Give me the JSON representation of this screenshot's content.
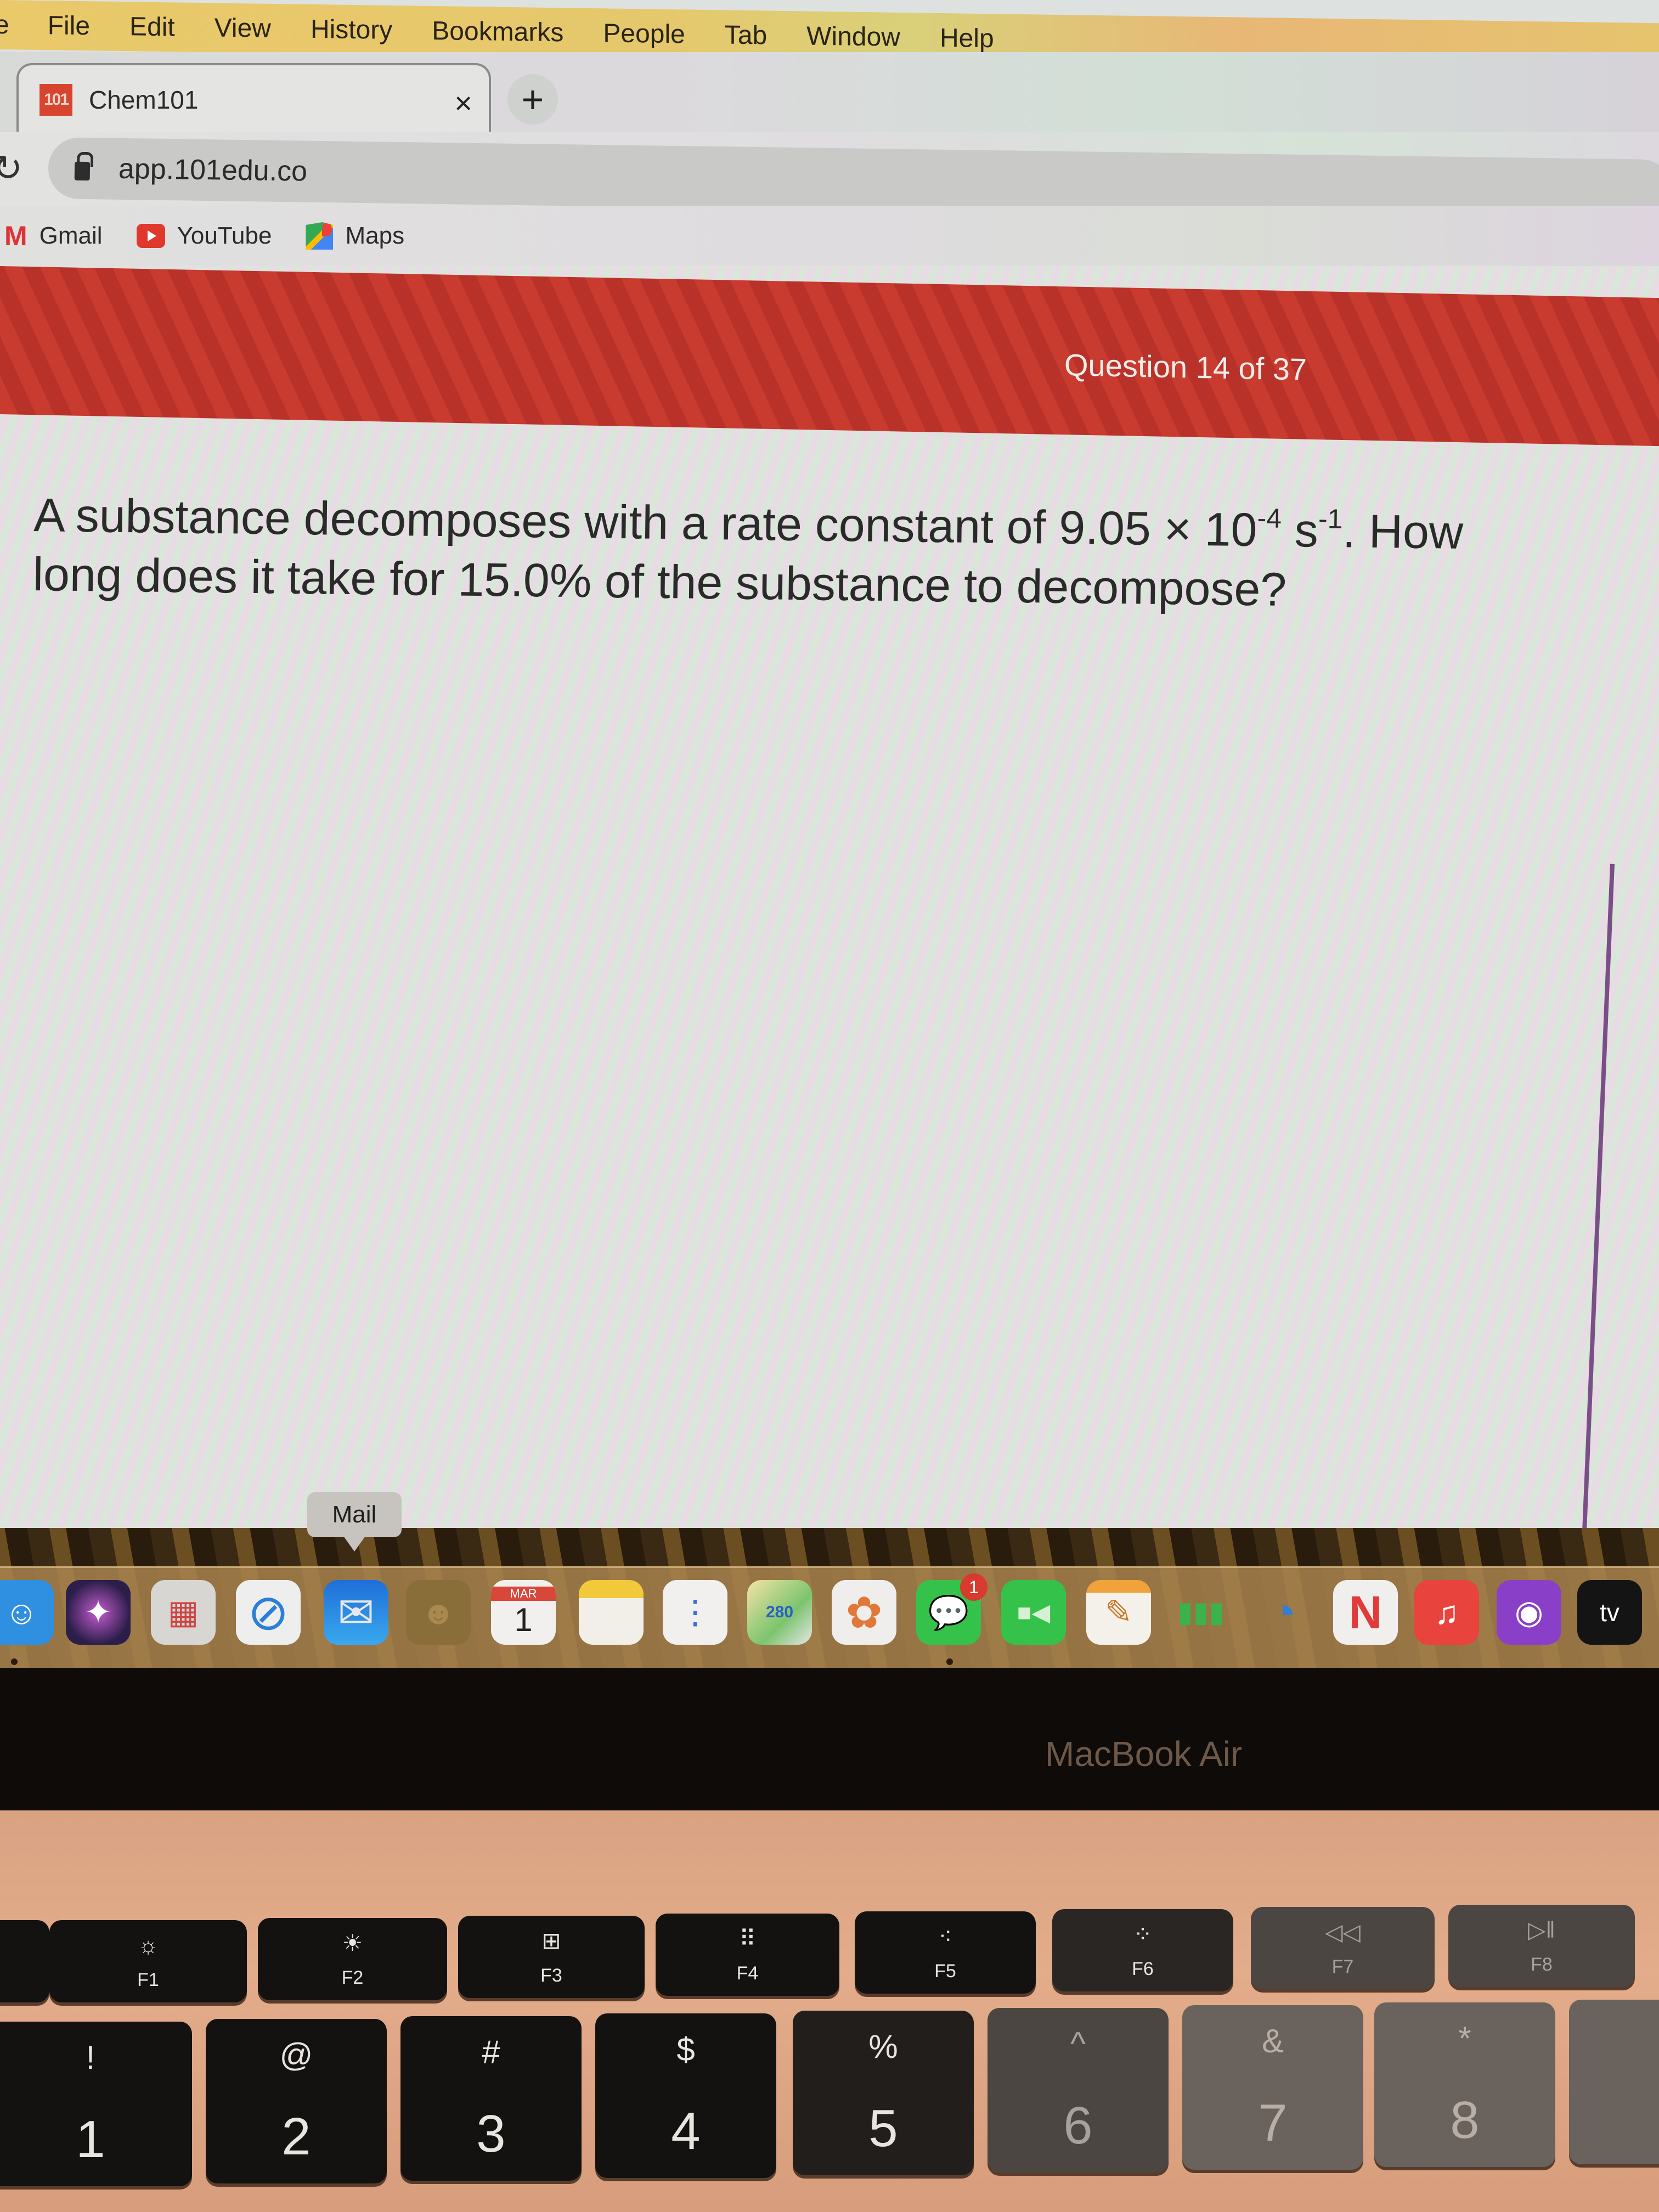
{
  "menubar": {
    "items": [
      "e",
      "File",
      "Edit",
      "View",
      "History",
      "Bookmarks",
      "People",
      "Tab",
      "Window",
      "Help"
    ]
  },
  "browser": {
    "tab": {
      "favicon_text": "101",
      "title": "Chem101",
      "close_glyph": "×"
    },
    "new_tab_glyph": "+",
    "reload_glyph": "↻",
    "address": "app.101edu.co",
    "bookmarks": [
      {
        "label": "Gmail",
        "icon": "gmail-icon"
      },
      {
        "label": "YouTube",
        "icon": "youtube-icon"
      },
      {
        "label": "Maps",
        "icon": "maps-icon"
      }
    ]
  },
  "quiz": {
    "counter": "Question 14 of 37",
    "question_part1": "A substance decomposes with a rate constant of 9.05 × 10",
    "exponent1": "-4",
    "question_part2": " s",
    "exponent2": "-1",
    "question_part3": ". How long does it take for 15.0% of the substance to decompose?",
    "header_color": "#c93a2f"
  },
  "dock": {
    "tooltip": "Mail",
    "apps": [
      {
        "name": "Finder",
        "glyph": "☺",
        "color": "#2f8fe0"
      },
      {
        "name": "Siri",
        "glyph": "✦",
        "color": "#2b1e4a"
      },
      {
        "name": "Launchpad",
        "glyph": "▦",
        "color": "#d8d6d2"
      },
      {
        "name": "Safari",
        "glyph": "⊘",
        "color": "#2c7fd6"
      },
      {
        "name": "Mail",
        "glyph": "✉",
        "color": "#1e7ee0"
      },
      {
        "name": "Contacts",
        "glyph": "☻",
        "color": "#8a6e3a"
      },
      {
        "name": "Calendar",
        "glyph": "1",
        "month": "MAR",
        "color": "#f2f0ee"
      },
      {
        "name": "Notes",
        "glyph": "",
        "color": "#f1efe8"
      },
      {
        "name": "Reminders",
        "glyph": "⋮",
        "color": "#f1f0ee"
      },
      {
        "name": "Maps",
        "glyph": "280",
        "color": "#7cc46e"
      },
      {
        "name": "Photos",
        "glyph": "✿",
        "color": "#f0eeec"
      },
      {
        "name": "Messages",
        "glyph": "💬",
        "color": "#35c24a",
        "badge": "1"
      },
      {
        "name": "FaceTime",
        "glyph": "■◀",
        "color": "#35c24a"
      },
      {
        "name": "Pages",
        "glyph": "✎",
        "color": "#f0a33a"
      },
      {
        "name": "Numbers",
        "glyph": "▮▮▮",
        "color": "#3cb34a"
      },
      {
        "name": "Keynote",
        "glyph": "◔",
        "color": "#2f7fd6"
      },
      {
        "name": "News",
        "glyph": "N",
        "color": "#f1efee"
      },
      {
        "name": "Music",
        "glyph": "♫",
        "color": "#e8433c"
      },
      {
        "name": "Podcasts",
        "glyph": "◉",
        "color": "#8a3fc8"
      },
      {
        "name": "TV",
        "glyph": "tv",
        "color": "#141414"
      }
    ]
  },
  "laptop": {
    "model": "MacBook Air",
    "function_keys": [
      {
        "label": "F1",
        "icon": "☼"
      },
      {
        "label": "F2",
        "icon": "☀"
      },
      {
        "label": "F3",
        "icon": "⊞"
      },
      {
        "label": "F4",
        "icon": "⠿"
      },
      {
        "label": "F5",
        "icon": "⁖"
      },
      {
        "label": "F6",
        "icon": "⁘"
      },
      {
        "label": "F7",
        "icon": "◁◁"
      },
      {
        "label": "F8",
        "icon": "▷‖"
      }
    ],
    "number_keys": [
      {
        "top": "!",
        "bottom": "1"
      },
      {
        "top": "@",
        "bottom": "2"
      },
      {
        "top": "#",
        "bottom": "3"
      },
      {
        "top": "$",
        "bottom": "4"
      },
      {
        "top": "%",
        "bottom": "5"
      },
      {
        "top": "^",
        "bottom": "6"
      },
      {
        "top": "&",
        "bottom": "7"
      },
      {
        "top": "*",
        "bottom": "8"
      }
    ]
  }
}
